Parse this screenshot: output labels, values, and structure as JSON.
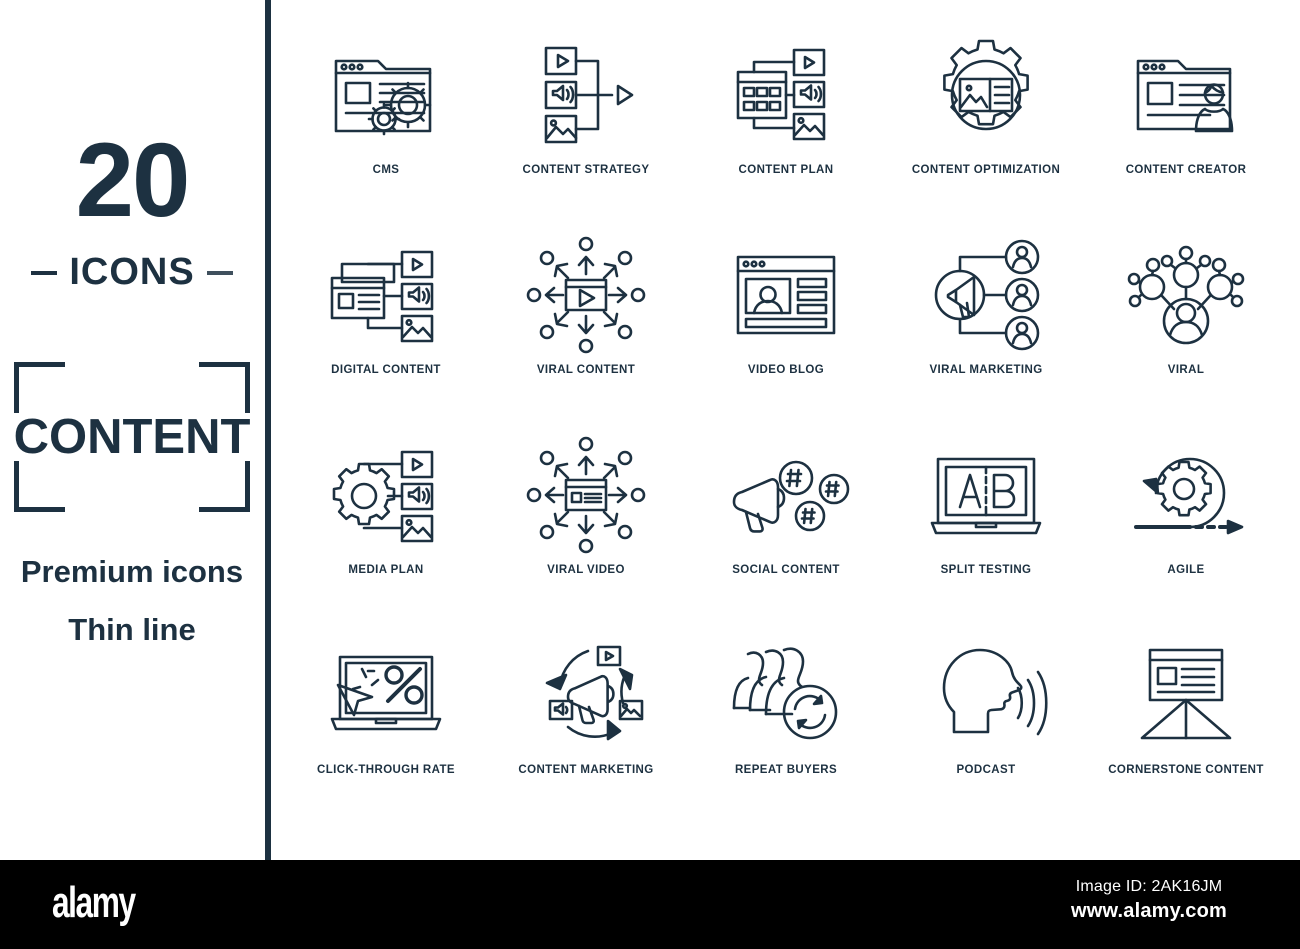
{
  "sidebar": {
    "count": "20",
    "count_label": "ICONS",
    "framed_title": "CONTENT",
    "tagline_1": "Premium icons",
    "tagline_2": "Thin line",
    "accent_color": "#1d3141"
  },
  "grid": {
    "columns": 5,
    "rows": 4,
    "items": [
      {
        "label": "CMS",
        "icon": "cms-icon"
      },
      {
        "label": "CONTENT STRATEGY",
        "icon": "content-strategy-icon"
      },
      {
        "label": "CONTENT PLAN",
        "icon": "content-plan-icon"
      },
      {
        "label": "CONTENT OPTIMIZATION",
        "icon": "content-optimization-icon"
      },
      {
        "label": "CONTENT CREATOR",
        "icon": "content-creator-icon"
      },
      {
        "label": "DIGITAL CONTENT",
        "icon": "digital-content-icon"
      },
      {
        "label": "VIRAL CONTENT",
        "icon": "viral-content-icon"
      },
      {
        "label": "VIDEO BLOG",
        "icon": "video-blog-icon"
      },
      {
        "label": "VIRAL MARKETING",
        "icon": "viral-marketing-icon"
      },
      {
        "label": "VIRAL",
        "icon": "viral-icon"
      },
      {
        "label": "MEDIA PLAN",
        "icon": "media-plan-icon"
      },
      {
        "label": "VIRAL VIDEO",
        "icon": "viral-video-icon"
      },
      {
        "label": "SOCIAL CONTENT",
        "icon": "social-content-icon"
      },
      {
        "label": "SPLIT TESTING",
        "icon": "split-testing-icon"
      },
      {
        "label": "AGILE",
        "icon": "agile-icon"
      },
      {
        "label": "CLICK-THROUGH RATE",
        "icon": "click-through-rate-icon"
      },
      {
        "label": "CONTENT MARKETING",
        "icon": "content-marketing-icon"
      },
      {
        "label": "REPEAT BUYERS",
        "icon": "repeat-buyers-icon"
      },
      {
        "label": "PODCAST",
        "icon": "podcast-icon"
      },
      {
        "label": "CORNERSTONE CONTENT",
        "icon": "cornerstone-content-icon"
      }
    ]
  },
  "footer": {
    "brand": "alamy",
    "image_id": "Image ID: 2AK16JM",
    "url": "www.alamy.com"
  }
}
